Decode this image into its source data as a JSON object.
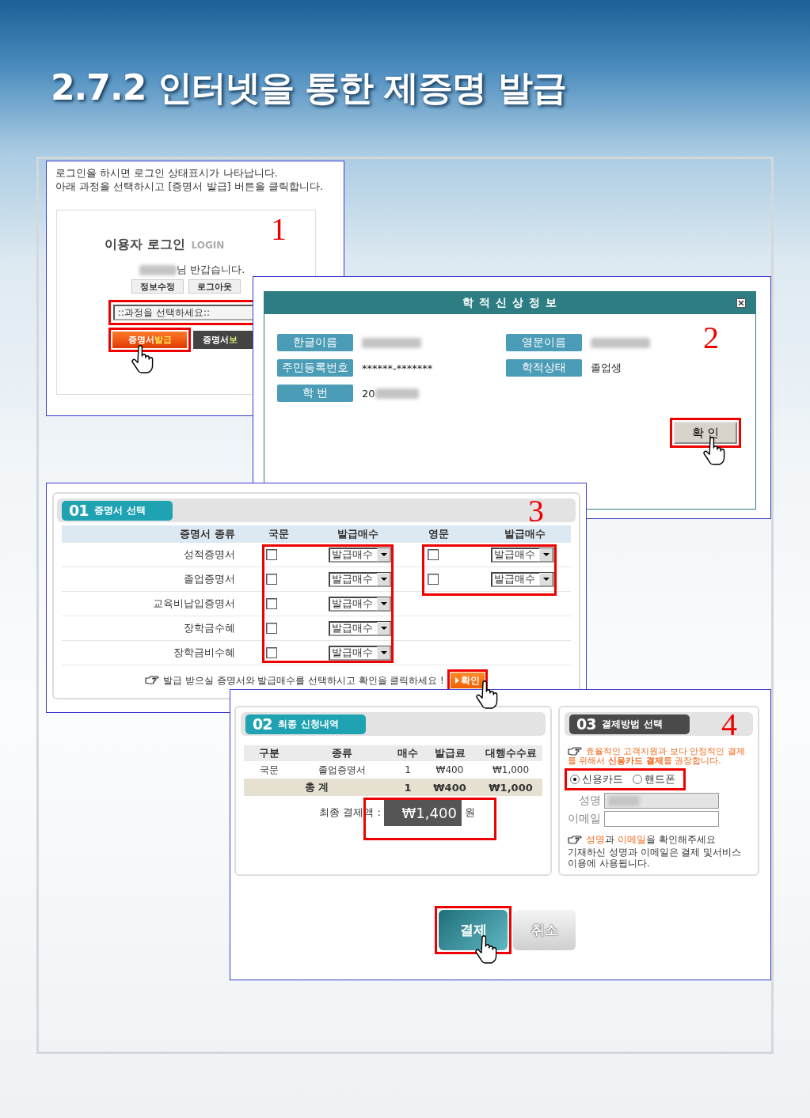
{
  "title": "2.7.2 인터넷을 통한 제증명 발급",
  "login": {
    "step": "1",
    "intro": [
      "로그인을 하시면 로그인 상태표시가 나타납니다.",
      "아래 과정을 선택하시고 [증명서 발급] 버튼을 클릭합니다."
    ],
    "heading": "이용자 로그인",
    "heading_en": "LOGIN",
    "name_redacted": true,
    "greeting": "님 반갑습니다.",
    "account_buttons": [
      "정보수정",
      "로그아웃"
    ],
    "course_select": {
      "value": "::과정을 선택하세요::"
    },
    "action_buttons": [
      {
        "kind": "issue",
        "label": [
          "증명서",
          "발급"
        ]
      },
      {
        "kind": "storage",
        "label": [
          "증명서",
          "보"
        ]
      }
    ]
  },
  "student_info": {
    "title": "학 적 신 상 정 보",
    "step": "2",
    "fields": [
      {
        "label": "한글이름",
        "redacted": true
      },
      {
        "label": "영문이름",
        "redacted": true
      },
      {
        "label": "주민등록번호",
        "value": "******-*******"
      },
      {
        "label": "학적상태",
        "value": "졸업생"
      },
      {
        "label": "학 번",
        "value": "20",
        "redacted": true
      }
    ],
    "confirm": "확 인"
  },
  "certificates": {
    "step": "3",
    "number": "01",
    "heading": "증명서 선택",
    "columns": [
      "증명서 종류",
      "국문",
      "발급매수",
      "영문",
      "발급매수"
    ],
    "rows": [
      {
        "name": "성적증명서",
        "korean": {
          "checked": false,
          "copies": "발급매수"
        },
        "english": {
          "checked": false,
          "copies": "발급매수"
        }
      },
      {
        "name": "졸업증명서",
        "korean": {
          "checked": false,
          "copies": "발급매수"
        },
        "english": {
          "checked": false,
          "copies": "발급매수"
        }
      },
      {
        "name": "교육비납입증명서",
        "korean": {
          "checked": false,
          "copies": "발급매수"
        }
      },
      {
        "name": "장학금수혜",
        "korean": {
          "checked": false,
          "copies": "발급매수"
        }
      },
      {
        "name": "장학금비수혜",
        "korean": {
          "checked": false,
          "copies": "발급매수"
        }
      }
    ],
    "note": "발급 받으실 증명서와 발급매수를 선택하시고 확인을 클릭하세요 !",
    "confirm": "확인"
  },
  "summary": {
    "number": "02",
    "heading": "최종 신청내역",
    "columns": [
      "구분",
      "종류",
      "매수",
      "발급료",
      "대행수수료"
    ],
    "rows": [
      [
        "국문",
        "졸업증명서",
        "1",
        "₩400",
        "₩1,000"
      ]
    ],
    "total": [
      "총 계",
      "1",
      "₩400",
      "₩1,000"
    ],
    "final_label": "최종 결제액 :",
    "final_amount": "₩1,400",
    "final_unit": "원"
  },
  "payment": {
    "step": "4",
    "number": "03",
    "heading": "결제방법 선택",
    "notice": "효율적인 고객지원과 보다 안정적인 결제를 위해서 **신용카드 결제**를 권장합니다.",
    "methods": [
      {
        "label": "신용카드",
        "selected": true
      },
      {
        "label": "핸드폰",
        "selected": false
      }
    ],
    "fields": [
      {
        "label": "성명",
        "disabled": true,
        "redacted": true
      },
      {
        "label": "이메일",
        "disabled": false
      }
    ],
    "check_note": [
      {
        "text": "성명",
        "highlight": true
      },
      {
        "text": "과 ",
        "highlight": false
      },
      {
        "text": "이메일",
        "highlight": true
      },
      {
        "text": "을 확인해주세요",
        "highlight": false
      }
    ],
    "usage_note": "기재하신 성명과 이메일은 결제 및서비스 이용에 사용됩니다."
  },
  "buttons": [
    {
      "label": "결제",
      "kind": "primary"
    },
    {
      "label": "취소",
      "kind": "disabled"
    }
  ]
}
